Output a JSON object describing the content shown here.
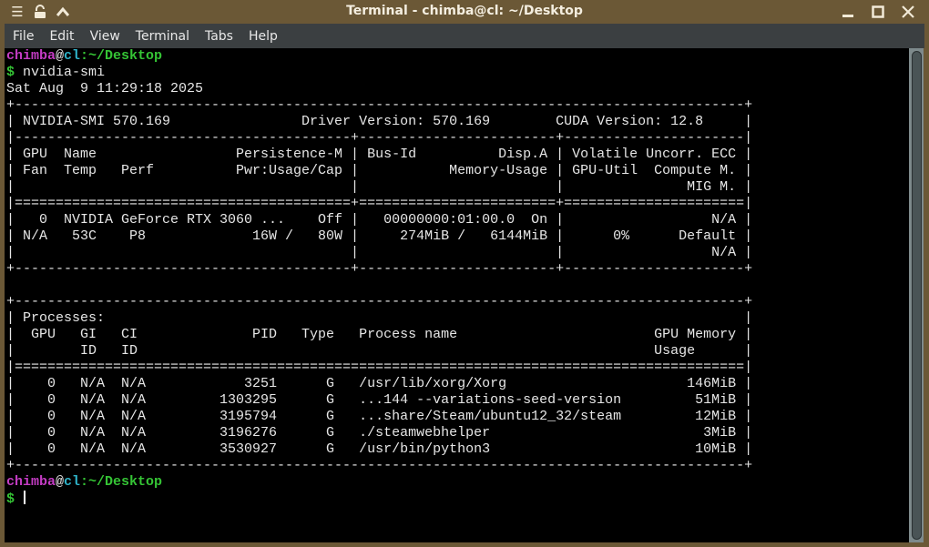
{
  "window": {
    "title": "Terminal - chimba@cl: ~/Desktop",
    "icons": [
      "menu-icon",
      "unlock-icon",
      "chevron-up-icon",
      "minimize-icon",
      "maximize-icon",
      "close-icon"
    ]
  },
  "menu": [
    "File",
    "Edit",
    "View",
    "Terminal",
    "Tabs",
    "Help"
  ],
  "prompt": {
    "user": "chimba",
    "at": "@",
    "host": "cl",
    "path": ":~/Desktop",
    "symbol": "$"
  },
  "command": " nvidia-smi",
  "output": [
    "Sat Aug  9 11:29:18 2025",
    "+-----------------------------------------------------------------------------------------+",
    "| NVIDIA-SMI 570.169                Driver Version: 570.169        CUDA Version: 12.8     |",
    "|-----------------------------------------+------------------------+----------------------|",
    "| GPU  Name                 Persistence-M | Bus-Id          Disp.A | Volatile Uncorr. ECC |",
    "| Fan  Temp   Perf          Pwr:Usage/Cap |           Memory-Usage | GPU-Util  Compute M. |",
    "|                                         |                        |               MIG M. |",
    "|=========================================+========================+======================|",
    "|   0  NVIDIA GeForce RTX 3060 ...    Off |   00000000:01:00.0  On |                  N/A |",
    "| N/A   53C    P8             16W /   80W |     274MiB /   6144MiB |      0%      Default |",
    "|                                         |                        |                  N/A |",
    "+-----------------------------------------+------------------------+----------------------+",
    "",
    "+-----------------------------------------------------------------------------------------+",
    "| Processes:                                                                              |",
    "|  GPU   GI   CI              PID   Type   Process name                        GPU Memory |",
    "|        ID   ID                                                               Usage      |",
    "|=========================================================================================|",
    "|    0   N/A  N/A            3251      G   /usr/lib/xorg/Xorg                      146MiB |",
    "|    0   N/A  N/A         1303295      G   ...144 --variations-seed-version         51MiB |",
    "|    0   N/A  N/A         3195794      G   ...share/Steam/ubuntu12_32/steam         12MiB |",
    "|    0   N/A  N/A         3196276      G   ./steamwebhelper                          3MiB |",
    "|    0   N/A  N/A         3530927      G   /usr/bin/python3                         10MiB |",
    "+-----------------------------------------------------------------------------------------+"
  ]
}
